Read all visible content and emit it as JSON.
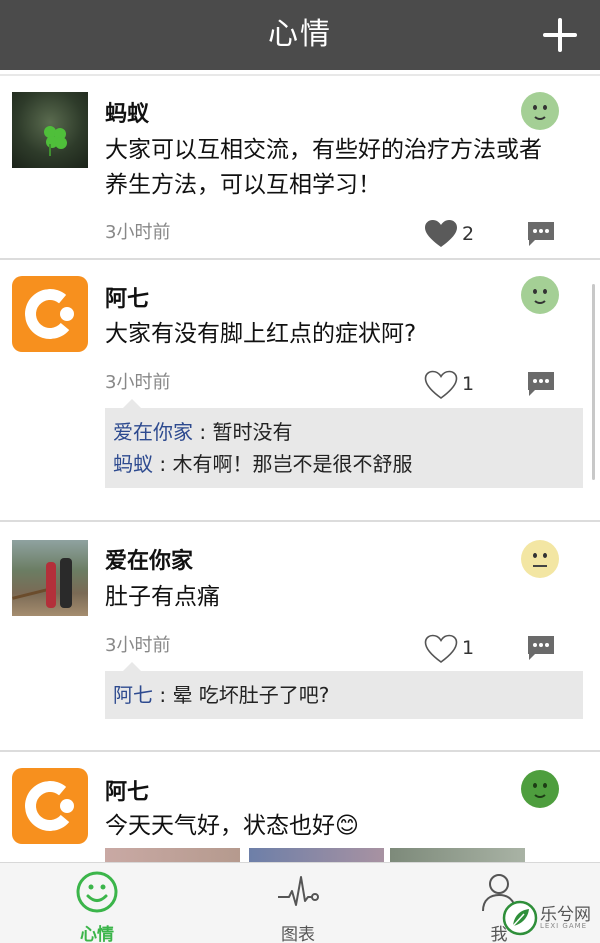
{
  "header": {
    "title": "心情",
    "add_icon": "plus-icon"
  },
  "colors": {
    "header_bg": "#4b4b4b",
    "accent_green": "#3bb54a",
    "comment_user": "#2d4a8f"
  },
  "posts": [
    {
      "user": "蚂蚁",
      "avatar": "clover-photo",
      "mood": "happy",
      "content_lines": [
        "大家可以互相交流，有些好的治疗方法或者",
        "养生方法，可以互相学习！"
      ],
      "time": "3小时前",
      "liked": true,
      "likes": "2",
      "comments": []
    },
    {
      "user": "阿七",
      "avatar": "orange-c-logo",
      "mood": "happy",
      "content_lines": [
        "大家有没有脚上红点的症状阿?"
      ],
      "time": "3小时前",
      "liked": false,
      "likes": "1",
      "comments": [
        {
          "user": "爱在你家",
          "sep": " : ",
          "text": "暂时没有"
        },
        {
          "user": "蚂蚁",
          "sep": " : ",
          "text": "木有啊！那岂不是很不舒服"
        }
      ]
    },
    {
      "user": "爱在你家",
      "avatar": "couple-photo",
      "mood": "neutral",
      "content_lines": [
        "肚子有点痛"
      ],
      "time": "3小时前",
      "liked": false,
      "likes": "1",
      "comments": [
        {
          "user": "阿七",
          "sep": " : ",
          "text": "晕 吃坏肚子了吧?"
        }
      ]
    },
    {
      "user": "阿七",
      "avatar": "orange-c-logo",
      "mood": "great",
      "content_lines": [
        "今天天气好，状态也好😊"
      ],
      "time": "",
      "liked": false,
      "likes": "",
      "comments": []
    }
  ],
  "tabbar": {
    "tabs": [
      {
        "label": "心情",
        "icon": "smiley-icon",
        "active": true
      },
      {
        "label": "图表",
        "icon": "heartbeat-chart-icon",
        "active": false
      },
      {
        "label": "我",
        "icon": "user-icon",
        "active": false
      }
    ]
  },
  "watermark": {
    "text": "乐兮网",
    "sub": "LEXI GAME"
  }
}
